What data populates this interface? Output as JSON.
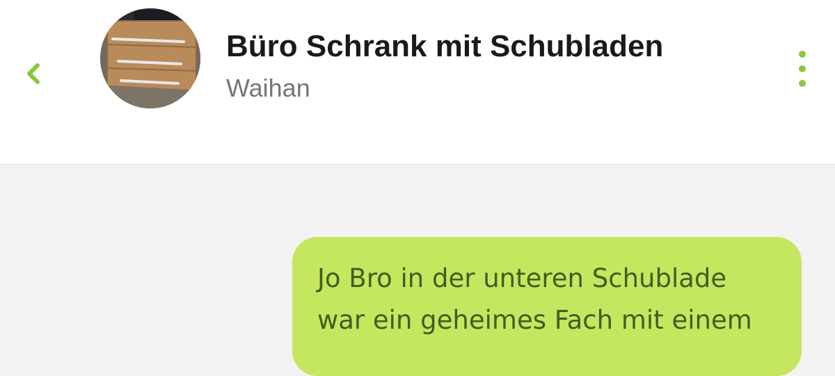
{
  "header": {
    "back_icon": "chevron-left-icon",
    "avatar_alt": "Büro Schrank mit Schubladen",
    "title": "Büro Schrank mit Schubladen",
    "subtitle": "Waihan",
    "menu_icon": "more-vertical-icon"
  },
  "messages": [
    {
      "direction": "outgoing",
      "text": "Jo Bro in der unteren Schublade\nwar ein geheimes Fach mit einem"
    }
  ],
  "colors": {
    "accent": "#8cc63f",
    "bubble_outgoing": "#c5e65f",
    "bubble_text": "#3f5f1f",
    "background": "#f2f2f2",
    "header_bg": "#ffffff"
  }
}
